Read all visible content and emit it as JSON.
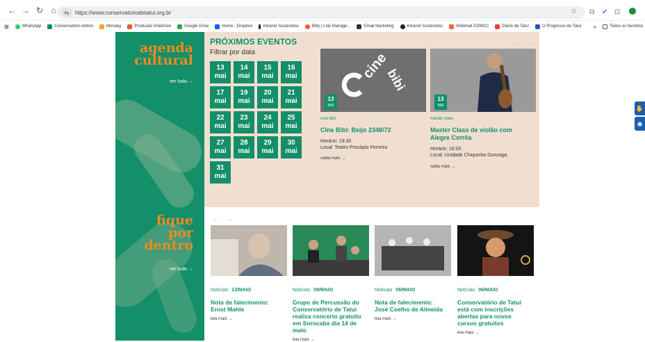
{
  "browser": {
    "url": "https://www.conservatoriodetatui.org.br",
    "bookmarks": [
      "WhatsApp",
      "Conservatório Admin",
      "Monday",
      "Produção OneDrive",
      "Google Drive",
      "Home - Dropbox",
      "Intranet Sustenidos",
      "Bitly | Link Manage...",
      "Email Marketing",
      "Intranet Sustenidos",
      "Webmail CDMCC",
      "Diário de Tatuí",
      "O Progresso de Tatuí"
    ],
    "bookmarks_more": "»",
    "all_favorites": "Todos os favoritos"
  },
  "agenda": {
    "title_line1": "agenda",
    "title_line2": "cultural",
    "link": "ver tudo →"
  },
  "fique": {
    "line1": "fique",
    "line2": "por",
    "line3": "dentro",
    "link": "ver tudo →"
  },
  "events": {
    "title": "PRÓXIMOS EVENTOS",
    "filter_label": "Filtrar por data",
    "dates": [
      {
        "d": "13",
        "m": "mai"
      },
      {
        "d": "14",
        "m": "mai"
      },
      {
        "d": "15",
        "m": "mai"
      },
      {
        "d": "16",
        "m": "mai"
      },
      {
        "d": "17",
        "m": "mai"
      },
      {
        "d": "19",
        "m": "mai"
      },
      {
        "d": "20",
        "m": "mai"
      },
      {
        "d": "21",
        "m": "mai"
      },
      {
        "d": "22",
        "m": "mai"
      },
      {
        "d": "23",
        "m": "mai"
      },
      {
        "d": "24",
        "m": "mai"
      },
      {
        "d": "25",
        "m": "mai"
      },
      {
        "d": "27",
        "m": "mai"
      },
      {
        "d": "28",
        "m": "mai"
      },
      {
        "d": "29",
        "m": "mai"
      },
      {
        "d": "30",
        "m": "mai"
      },
      {
        "d": "31",
        "m": "mai"
      }
    ],
    "items": [
      {
        "badge_day": "13",
        "badge_month": "MAI",
        "image_text": "cine bibi",
        "category": "cine bibi",
        "title": "Cine Bibi: Beijo 2348/72",
        "time": "Horário: 19:30",
        "place": "Local: Teatro Procópio Ferreira",
        "more": "saiba mais →"
      },
      {
        "badge_day": "13",
        "badge_month": "MAI",
        "category": "master class",
        "title_line1": "Master Class de violão com",
        "title_line2": "Alegre Corrêa",
        "time": "Horário: 16:00",
        "place": "Local: Unidade Chiquinha Gonzaga",
        "more": "saiba mais →"
      }
    ]
  },
  "news": [
    {
      "type": "Notícias",
      "date": "13/MAIO",
      "lines": [
        "Nota de falecimento:",
        "Ernst Mahle"
      ],
      "more": "leia mais →"
    },
    {
      "type": "Notícias",
      "date": "09/MAIO",
      "lines": [
        "Grupo de Percussão do",
        "Conservatório de Tatuí",
        "realiza concerto gratuito",
        "em Sorocaba dia 14 de",
        "maio"
      ],
      "more": "leia mais →"
    },
    {
      "type": "Notícias",
      "date": "06/MAIO",
      "lines": [
        "Nota de falecimento:",
        "José Coelho de Almeida"
      ],
      "more": "leia mais →"
    },
    {
      "type": "Notícias",
      "date": "06/MAIO",
      "lines": [
        "Conservatório de Tatuí",
        "está com inscrições",
        "abertas para novos",
        "cursos gratuitos"
      ],
      "more": "leia mais →"
    }
  ],
  "colors": {
    "brand_green": "#138f6a",
    "accent_orange": "#f08a1e",
    "events_bg": "#f0dfd0"
  }
}
